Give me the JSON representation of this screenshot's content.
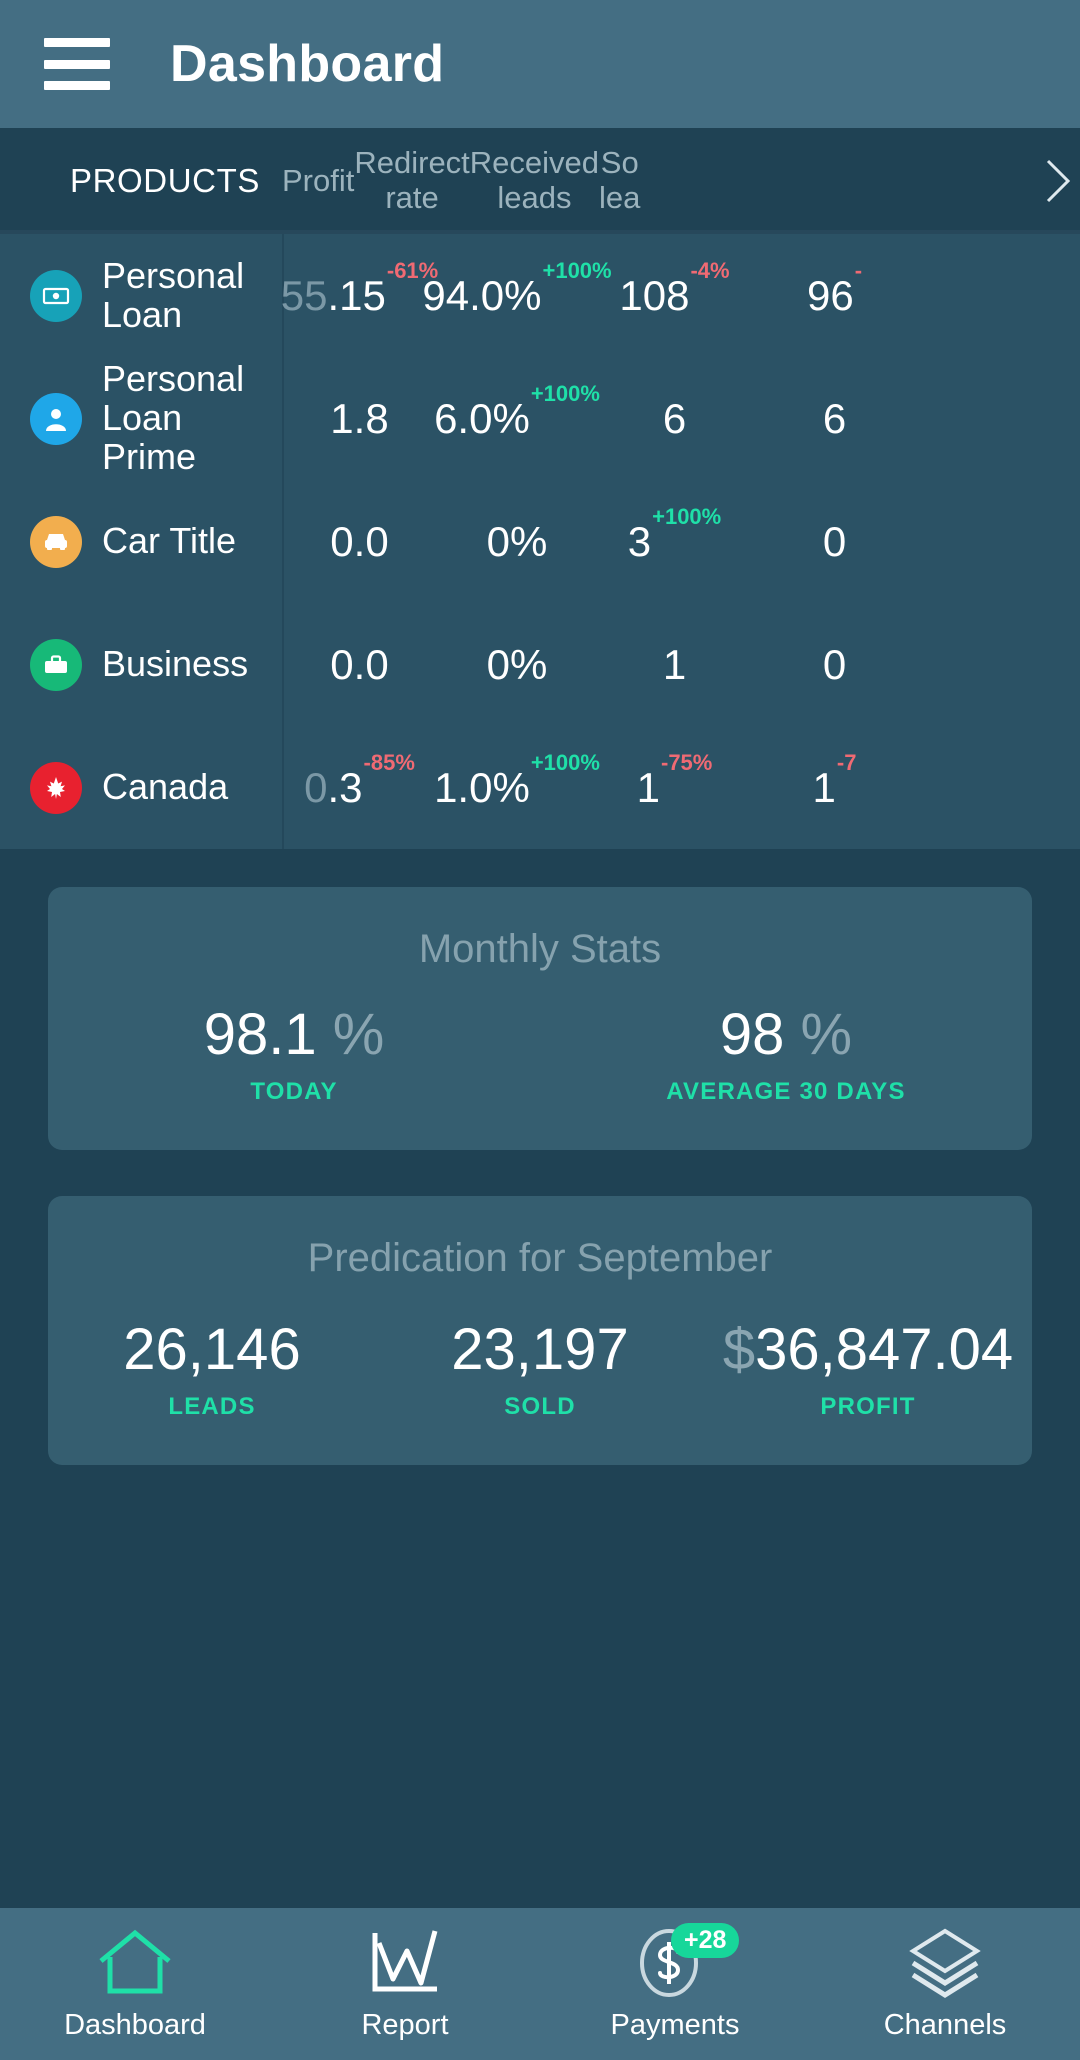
{
  "appbar": {
    "menu_icon": "hamburger-menu-icon",
    "title": "Dashboard"
  },
  "table": {
    "columns": [
      {
        "label": "PRODUCTS",
        "key": "products"
      },
      {
        "label": "Profit",
        "key": "profit"
      },
      {
        "label": "Redirect\nrate",
        "line1": "Redirect",
        "line2": "rate"
      },
      {
        "label": "Received\nleads",
        "line1": "Received",
        "line2": "leads"
      },
      {
        "label": "Sold leads",
        "line1": "So",
        "line2": "lea"
      }
    ],
    "scroll_hint_icon": "chevron-right-icon",
    "rows": [
      {
        "name": "Personal Loan",
        "icon": "money-bill-icon",
        "icon_color": "#17a2b8",
        "profit": "55.15",
        "profit_dim": "55",
        "profit_rest": ".15",
        "profit_delta": "-61%",
        "profit_delta_dir": "down",
        "redirect_rate": "94.0%",
        "redirect_delta": "+100%",
        "redirect_delta_dir": "up",
        "received_leads": "108",
        "received_delta": "-4%",
        "received_delta_dir": "down",
        "sold_leads": "96",
        "sold_delta": "-",
        "sold_delta_dir": "down"
      },
      {
        "name": "Personal Loan Prime",
        "icon": "user-icon",
        "icon_color": "#1fa7e8",
        "profit": "1.8",
        "profit_dim": "",
        "profit_rest": "1.8",
        "profit_delta": "",
        "profit_delta_dir": "",
        "redirect_rate": "6.0%",
        "redirect_delta": "+100%",
        "redirect_delta_dir": "up",
        "received_leads": "6",
        "received_delta": "",
        "received_delta_dir": "",
        "sold_leads": "6",
        "sold_delta": "",
        "sold_delta_dir": ""
      },
      {
        "name": "Car Title",
        "icon": "car-icon",
        "icon_color": "#f2ae4e",
        "profit": "0.0",
        "profit_dim": "",
        "profit_rest": "0.0",
        "profit_delta": "",
        "profit_delta_dir": "",
        "redirect_rate": "0%",
        "redirect_delta": "",
        "redirect_delta_dir": "",
        "received_leads": "3",
        "received_delta": "+100%",
        "received_delta_dir": "up",
        "sold_leads": "0",
        "sold_delta": "",
        "sold_delta_dir": ""
      },
      {
        "name": "Business",
        "icon": "briefcase-icon",
        "icon_color": "#17b978",
        "profit": "0.0",
        "profit_dim": "",
        "profit_rest": "0.0",
        "profit_delta": "",
        "profit_delta_dir": "",
        "redirect_rate": "0%",
        "redirect_delta": "",
        "redirect_delta_dir": "",
        "received_leads": "1",
        "received_delta": "",
        "received_delta_dir": "",
        "sold_leads": "0",
        "sold_delta": "",
        "sold_delta_dir": ""
      },
      {
        "name": "Canada",
        "icon": "canada-flag-icon",
        "icon_color": "#e8212f",
        "profit": "0.3",
        "profit_dim": "0",
        "profit_rest": ".3",
        "profit_delta": "-85%",
        "profit_delta_dir": "down",
        "redirect_rate": "1.0%",
        "redirect_delta": "+100%",
        "redirect_delta_dir": "up",
        "received_leads": "1",
        "received_delta": "-75%",
        "received_delta_dir": "down",
        "sold_leads": "1",
        "sold_delta": "-7",
        "sold_delta_dir": "down"
      }
    ]
  },
  "monthly_stats": {
    "title": "Monthly Stats",
    "items": [
      {
        "value": "98.1",
        "unit": "%",
        "label": "TODAY"
      },
      {
        "value": "98",
        "unit": "%",
        "label": "AVERAGE 30 DAYS"
      }
    ]
  },
  "prediction": {
    "title": "Predication for September",
    "items": [
      {
        "prefix": "",
        "value": "26,146",
        "label": "LEADS"
      },
      {
        "prefix": "",
        "value": "23,197",
        "label": "SOLD"
      },
      {
        "prefix": "$",
        "value": "36,847.04",
        "label": "PROFIT"
      }
    ]
  },
  "bottom_nav": {
    "items": [
      {
        "label": "Dashboard",
        "icon": "home-icon",
        "active": true,
        "badge": ""
      },
      {
        "label": "Report",
        "icon": "line-chart-icon",
        "active": false,
        "badge": ""
      },
      {
        "label": "Payments",
        "icon": "dollar-circle-icon",
        "active": false,
        "badge": "+28"
      },
      {
        "label": "Channels",
        "icon": "layers-icon",
        "active": false,
        "badge": ""
      }
    ]
  },
  "colors": {
    "appbar": "#446e83",
    "table_header": "#1f4254",
    "table_body": "#2b5265",
    "card": "#355e70",
    "accent_green": "#1fe0a8",
    "accent_red": "#f06a73"
  }
}
